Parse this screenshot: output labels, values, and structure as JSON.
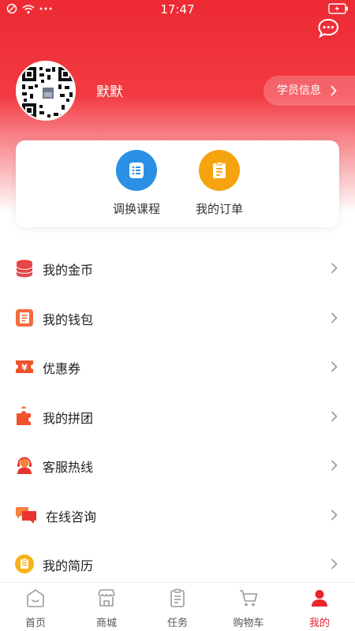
{
  "status_bar": {
    "time": "17:47"
  },
  "profile": {
    "username": "默默",
    "student_info_label": "学员信息"
  },
  "quick_actions": [
    {
      "label": "调换课程",
      "icon": "list-icon",
      "color": "#2b8fe6"
    },
    {
      "label": "我的订单",
      "icon": "clipboard-icon",
      "color": "#f5a40f"
    }
  ],
  "menu": [
    {
      "label": "我的金币",
      "icon": "coins-icon"
    },
    {
      "label": "我的钱包",
      "icon": "wallet-icon"
    },
    {
      "label": "优惠券",
      "icon": "coupon-icon"
    },
    {
      "label": "我的拼团",
      "icon": "puzzle-icon"
    },
    {
      "label": "客服热线",
      "icon": "headset-icon"
    },
    {
      "label": "在线咨询",
      "icon": "chat-icon"
    },
    {
      "label": "我的简历",
      "icon": "resume-icon"
    }
  ],
  "tabs": [
    {
      "label": "首页",
      "icon": "home-icon"
    },
    {
      "label": "商城",
      "icon": "store-icon"
    },
    {
      "label": "任务",
      "icon": "task-icon"
    },
    {
      "label": "购物车",
      "icon": "cart-icon"
    },
    {
      "label": "我的",
      "icon": "profile-icon",
      "active": true
    }
  ],
  "colors": {
    "brand_red": "#ee2a33",
    "tab_active": "#e8242f"
  }
}
